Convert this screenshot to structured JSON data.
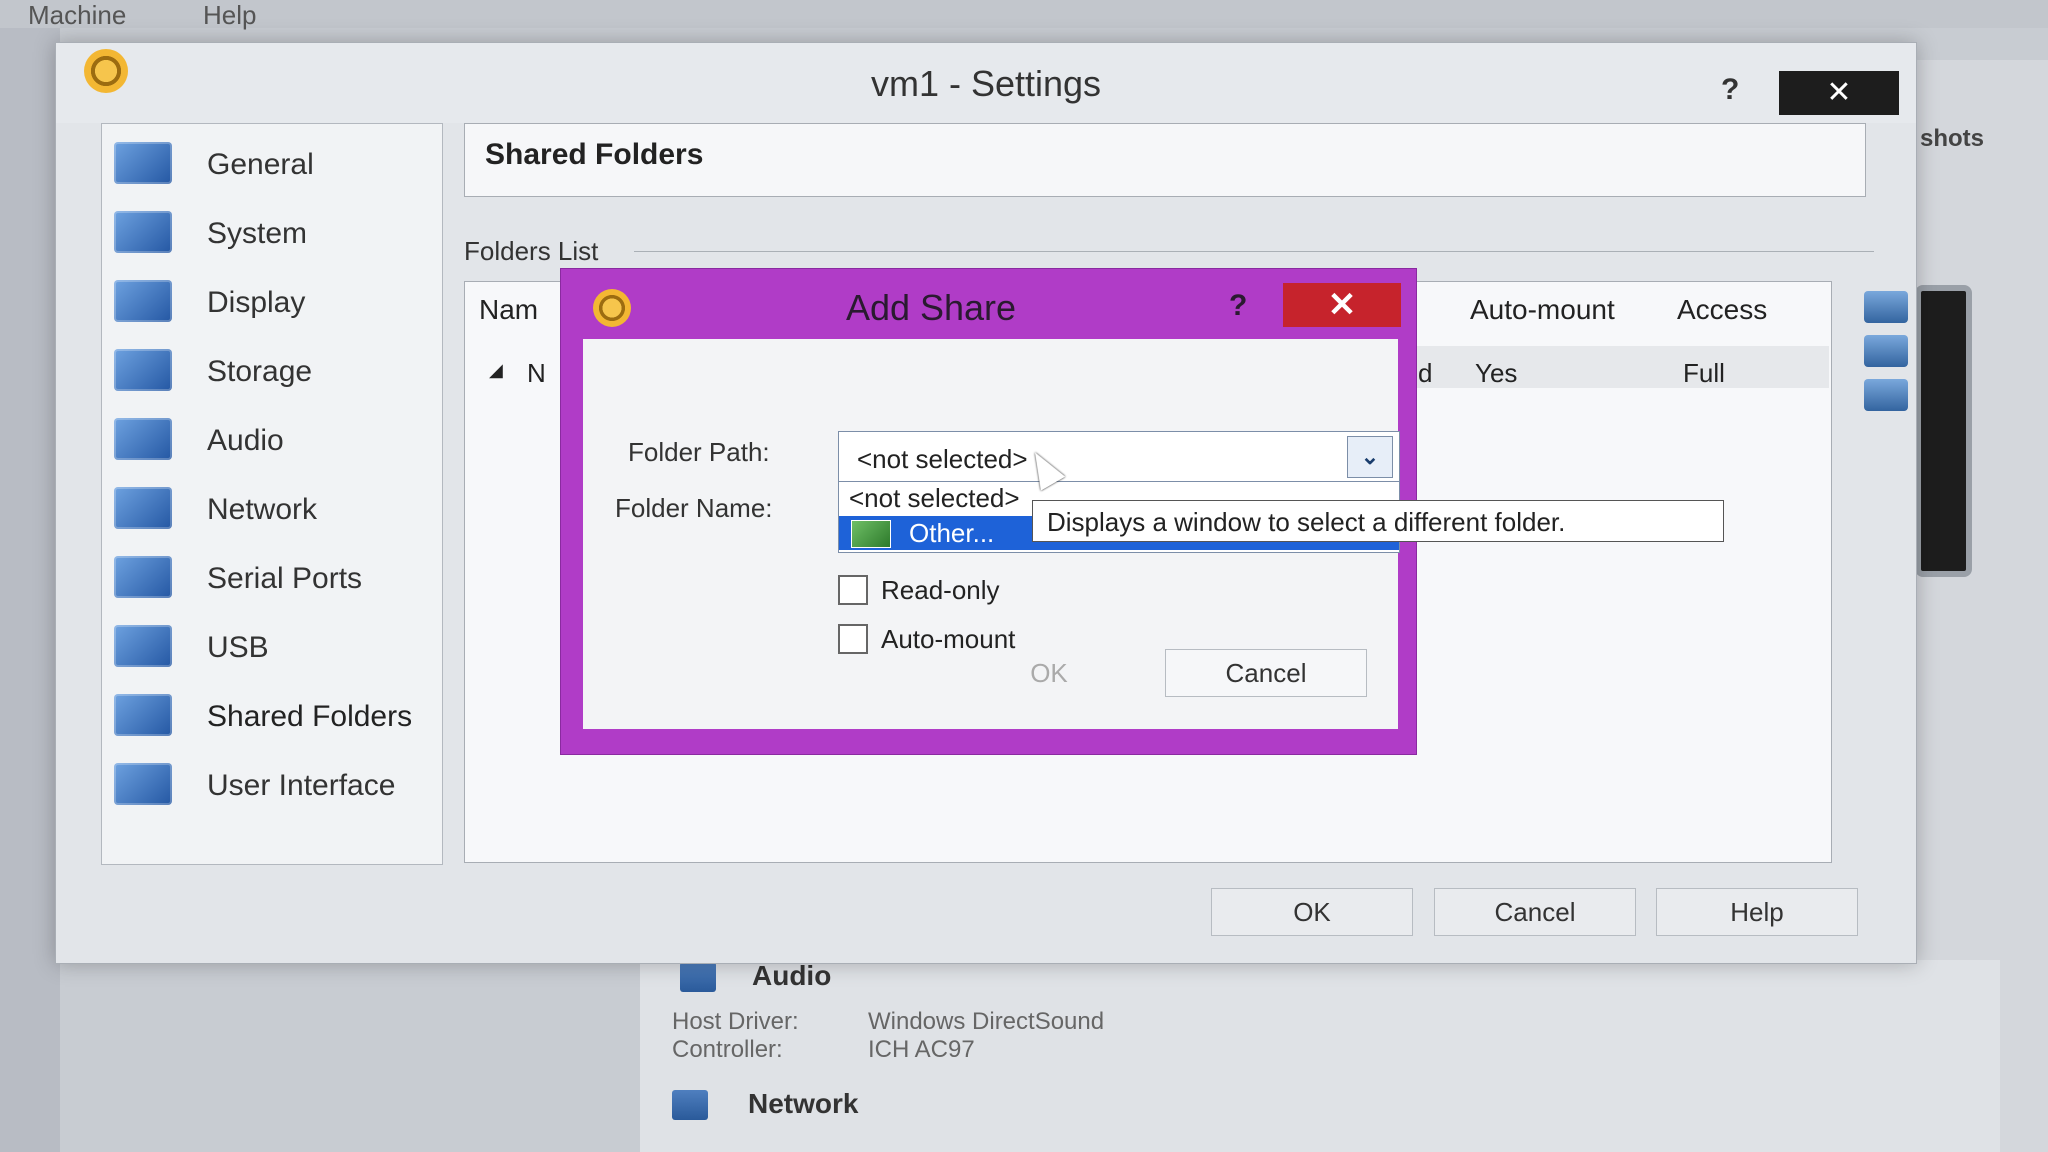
{
  "background": {
    "menubar": [
      "Machine",
      "Help"
    ],
    "right_label": "shots",
    "details": {
      "audio_heading": "Audio",
      "host_driver_label": "Host Driver:",
      "host_driver_value": "Windows DirectSound",
      "controller_label": "Controller:",
      "controller_value": "ICH AC97",
      "network_heading": "Network"
    }
  },
  "settings": {
    "title": "vm1 - Settings",
    "help_label": "?",
    "close_label": "✕",
    "sidebar": [
      {
        "label": "General",
        "icon": "general-icon"
      },
      {
        "label": "System",
        "icon": "system-icon"
      },
      {
        "label": "Display",
        "icon": "display-icon"
      },
      {
        "label": "Storage",
        "icon": "storage-icon"
      },
      {
        "label": "Audio",
        "icon": "audio-icon"
      },
      {
        "label": "Network",
        "icon": "network-icon"
      },
      {
        "label": "Serial Ports",
        "icon": "serial-ports-icon"
      },
      {
        "label": "USB",
        "icon": "usb-icon"
      },
      {
        "label": "Shared Folders",
        "icon": "shared-folders-icon"
      },
      {
        "label": "User Interface",
        "icon": "user-interface-icon"
      }
    ],
    "selected": "Shared Folders",
    "page_heading": "Shared Folders",
    "folders_list_label": "Folders List",
    "table": {
      "headers": [
        "Nam",
        "Auto-mount",
        "Access"
      ],
      "row": {
        "first": "N",
        "auto_mount_fragment": "d",
        "auto_mount": "Yes",
        "access": "Full"
      }
    },
    "buttons": {
      "ok": "OK",
      "cancel": "Cancel",
      "help": "Help"
    }
  },
  "add_share": {
    "title": "Add Share",
    "help_label": "?",
    "close_label": "✕",
    "folder_path_label": "Folder Path:",
    "folder_name_label": "Folder Name:",
    "folder_path_value": "<not selected>",
    "options": [
      "<not selected>",
      "Other..."
    ],
    "highlighted_option": "Other...",
    "read_only_label": "Read-only",
    "auto_mount_label": "Auto-mount",
    "read_only_checked": false,
    "auto_mount_checked": false,
    "ok_label": "OK",
    "cancel_label": "Cancel",
    "tooltip": "Displays a window to select a different folder."
  },
  "colors": {
    "dialog_frame": "#b03cc7",
    "close_button": "#c6232c",
    "highlight": "#1e62d8"
  }
}
